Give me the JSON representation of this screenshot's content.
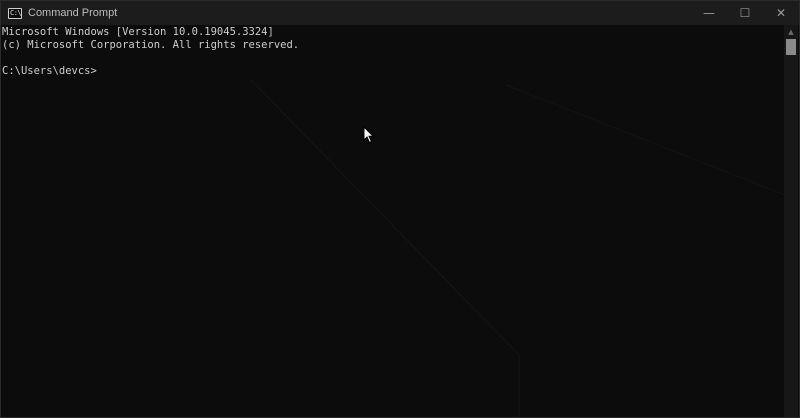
{
  "window": {
    "title": "Command Prompt",
    "icon": "terminal-icon",
    "icon_glyph": "C:\\"
  },
  "controls": {
    "minimize": "—",
    "maximize": "☐",
    "close": "✕"
  },
  "terminal": {
    "lines": [
      "Microsoft Windows [Version 10.0.19045.3324]",
      "(c) Microsoft Corporation. All rights reserved.",
      "",
      "C:\\Users\\devcs>"
    ]
  },
  "scrollbar": {
    "up_arrow": "▲"
  },
  "colors": {
    "background": "#0c0c0c",
    "titlebar": "#1c1c1c",
    "text": "#cccccc"
  }
}
